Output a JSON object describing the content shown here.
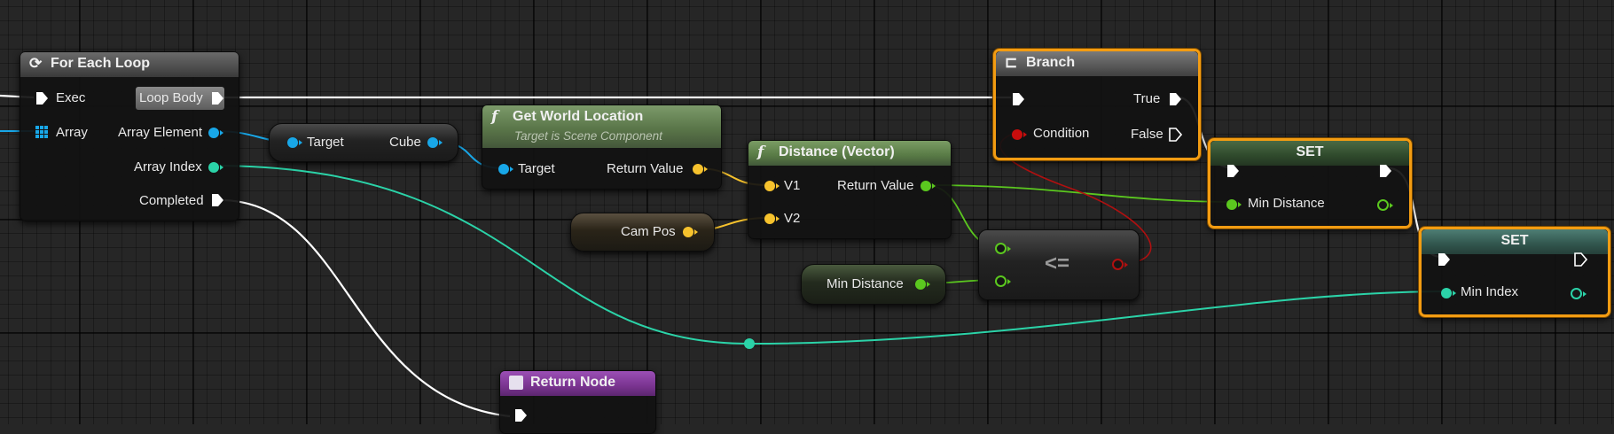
{
  "colors": {
    "exec": "#ffffff",
    "object": "#18a7e8",
    "int": "#2bd3a8",
    "vector": "#f6c22d",
    "float": "#5bc81f",
    "bool": "#c80d0d",
    "selection": "#f39c12"
  },
  "for_each": {
    "title": "For Each Loop",
    "icon": "loop-icon",
    "exec": "Exec",
    "loop_body": "Loop Body",
    "array": "Array",
    "array_element": "Array Element",
    "array_index": "Array Index",
    "completed": "Completed"
  },
  "target_cube": {
    "target": "Target",
    "cube": "Cube"
  },
  "get_world": {
    "title": "Get World Location",
    "subtitle": "Target is Scene Component",
    "target": "Target",
    "return_value": "Return Value",
    "icon": "function-icon"
  },
  "distance": {
    "title": "Distance (Vector)",
    "v1": "V1",
    "v2": "V2",
    "return_value": "Return Value",
    "icon": "function-icon"
  },
  "cam_pos": {
    "label": "Cam Pos"
  },
  "min_distance_get": {
    "label": "Min Distance"
  },
  "compare": {
    "op": "<="
  },
  "branch": {
    "title": "Branch",
    "icon": "branch-icon",
    "true": "True",
    "false": "False",
    "condition": "Condition"
  },
  "set_min_distance": {
    "title": "SET",
    "var": "Min Distance"
  },
  "set_min_index": {
    "title": "SET",
    "var": "Min Index"
  },
  "return_node": {
    "title": "Return Node",
    "icon": "return-icon"
  }
}
